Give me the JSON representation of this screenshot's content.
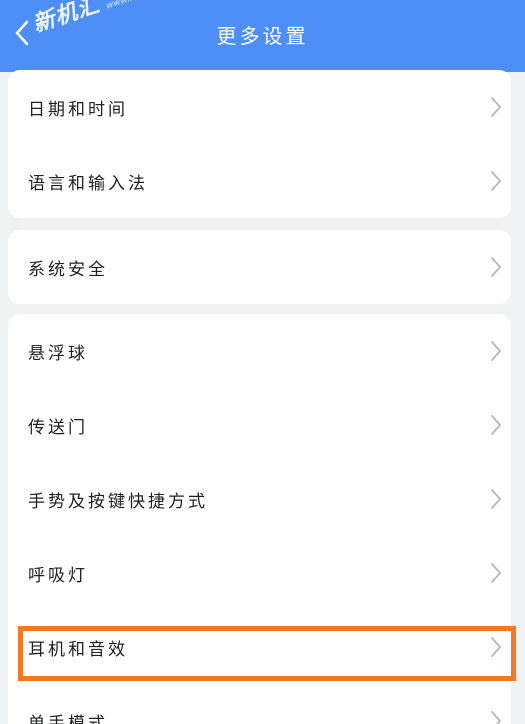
{
  "header": {
    "title": "更多设置",
    "watermark": {
      "main": "新机汇",
      "sub": "www.xianshua.net"
    }
  },
  "groups": [
    {
      "items": [
        {
          "label": "日期和时间"
        },
        {
          "label": "语言和输入法"
        }
      ]
    },
    {
      "items": [
        {
          "label": "系统安全"
        }
      ]
    },
    {
      "items": [
        {
          "label": "悬浮球"
        },
        {
          "label": "传送门"
        },
        {
          "label": "手势及按键快捷方式"
        },
        {
          "label": "呼吸灯"
        },
        {
          "label": "耳机和音效"
        },
        {
          "label": "单手模式"
        }
      ]
    }
  ],
  "colors": {
    "header_bg": "#4d8ff7",
    "page_bg": "#f1f2f4",
    "highlight_border": "#f27921"
  },
  "icons": {
    "back": "chevron-left-icon",
    "row_arrow": "chevron-right-icon"
  },
  "highlighted_item": "耳机和音效"
}
